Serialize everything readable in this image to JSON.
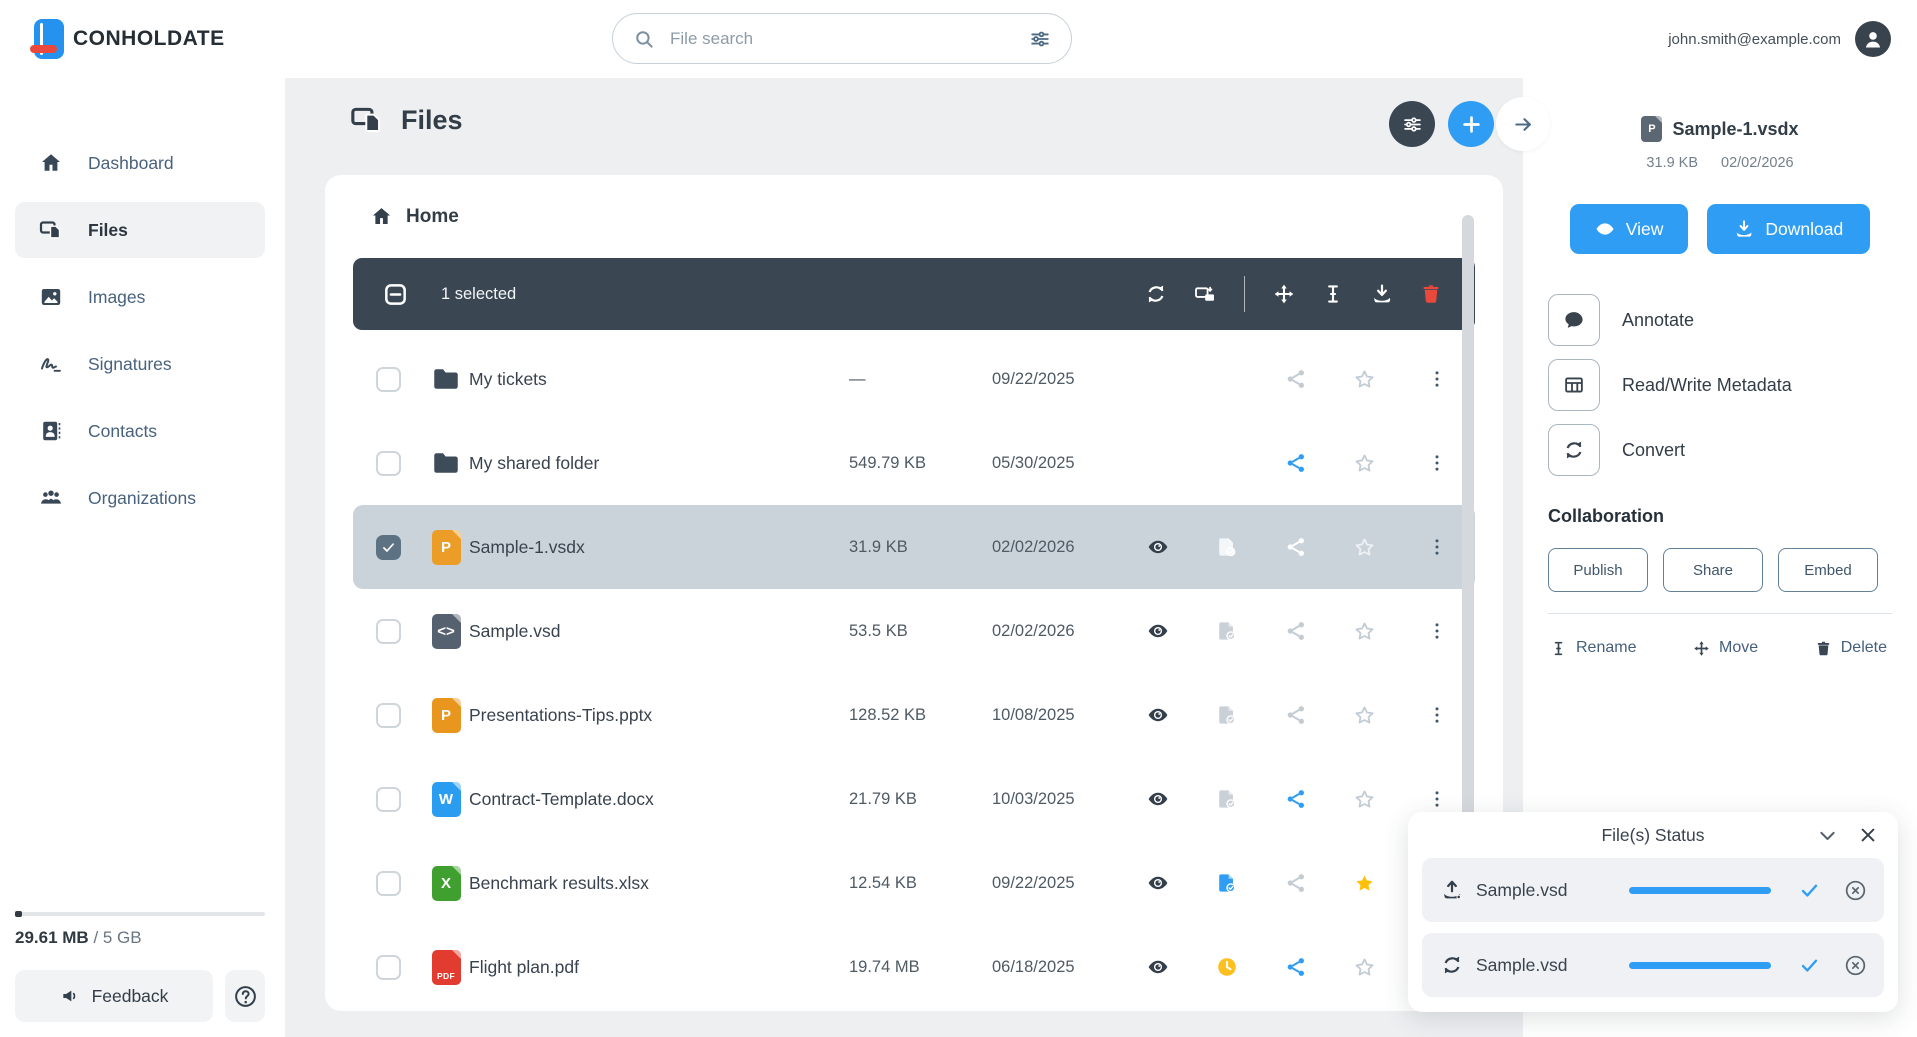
{
  "brand": {
    "name": "CONHOLDATE"
  },
  "topbar": {
    "search_placeholder": "File search",
    "user_email": "john.smith@example.com"
  },
  "sidebar": {
    "items": [
      {
        "label": "Dashboard",
        "icon": "home",
        "active": false
      },
      {
        "label": "Files",
        "icon": "files",
        "active": true
      },
      {
        "label": "Images",
        "icon": "image",
        "active": false
      },
      {
        "label": "Signatures",
        "icon": "signature",
        "active": false
      },
      {
        "label": "Contacts",
        "icon": "contact",
        "active": false
      },
      {
        "label": "Organizations",
        "icon": "people",
        "active": false
      }
    ],
    "storage": {
      "used": "29.61 MB",
      "quota": "/ 5 GB",
      "percent": 1
    },
    "feedback_label": "Feedback"
  },
  "main": {
    "title": "Files",
    "breadcrumb": {
      "label": "Home"
    },
    "header_buttons": [
      {
        "name": "filter",
        "icon": "sliders"
      },
      {
        "name": "add",
        "icon": "plus"
      }
    ],
    "toolbar": {
      "selected_text": "1 selected",
      "actions": [
        {
          "name": "convert",
          "icon": "refresh"
        },
        {
          "name": "compare",
          "icon": "compare"
        },
        {
          "divider": true
        },
        {
          "name": "move",
          "icon": "move"
        },
        {
          "name": "rename",
          "icon": "ibeam"
        },
        {
          "name": "download",
          "icon": "download"
        },
        {
          "name": "delete",
          "icon": "trash",
          "danger": true
        }
      ]
    },
    "file_types": {
      "folder": {
        "badge": "",
        "color": "#3e4b59"
      },
      "vsdx": {
        "badge": "P",
        "color": "#eb9d27"
      },
      "vsd": {
        "badge": "<>",
        "color": "#55616e"
      },
      "pptx": {
        "badge": "P",
        "color": "#e8961e"
      },
      "docx": {
        "badge": "W",
        "color": "#2b9df0"
      },
      "xlsx": {
        "badge": "X",
        "color": "#3f9f2f"
      },
      "pdf": {
        "badge": "PDF",
        "color": "#e23c30"
      }
    },
    "files": [
      {
        "name": "My tickets",
        "type": "folder",
        "size": "—",
        "date": "09/22/2025",
        "selected": false,
        "actions": {
          "share": "muted",
          "star": "outline",
          "menu": true
        }
      },
      {
        "name": "My shared folder",
        "type": "folder",
        "size": "549.79 KB",
        "date": "05/30/2025",
        "selected": false,
        "actions": {
          "share": "blue",
          "star": "outline",
          "menu": true
        }
      },
      {
        "name": "Sample-1.vsdx",
        "type": "vsdx",
        "size": "31.9 KB",
        "date": "02/02/2026",
        "selected": true,
        "actions": {
          "eye": true,
          "doc": "light",
          "share": "white",
          "star": "light-outline",
          "menu": true
        }
      },
      {
        "name": "Sample.vsd",
        "type": "vsd",
        "size": "53.5 KB",
        "date": "02/02/2026",
        "selected": false,
        "actions": {
          "eye": true,
          "doc": "muted",
          "share": "muted",
          "star": "outline",
          "menu": true
        }
      },
      {
        "name": "Presentations-Tips.pptx",
        "type": "pptx",
        "size": "128.52 KB",
        "date": "10/08/2025",
        "selected": false,
        "actions": {
          "eye": true,
          "doc": "muted",
          "share": "muted",
          "star": "outline",
          "menu": true
        }
      },
      {
        "name": "Contract-Template.docx",
        "type": "docx",
        "size": "21.79 KB",
        "date": "10/03/2025",
        "selected": false,
        "actions": {
          "eye": true,
          "doc": "muted",
          "share": "blue",
          "star": "outline",
          "menu": true
        }
      },
      {
        "name": "Benchmark results.xlsx",
        "type": "xlsx",
        "size": "12.54 KB",
        "date": "09/22/2025",
        "selected": false,
        "actions": {
          "eye": true,
          "doc": "blue",
          "share": "muted",
          "star": "filled",
          "menu": true
        }
      },
      {
        "name": "Flight plan.pdf",
        "type": "pdf",
        "size": "19.74 MB",
        "date": "06/18/2025",
        "selected": false,
        "actions": {
          "eye": true,
          "clock": true,
          "share": "blue",
          "star": "outline",
          "menu": true
        }
      }
    ]
  },
  "details": {
    "file_name": "Sample-1.vsdx",
    "file_type_badge": "P",
    "file_size": "31.9 KB",
    "file_date": "02/02/2026",
    "view_label": "View",
    "download_label": "Download",
    "actions": [
      {
        "label": "Annotate",
        "icon": "speech"
      },
      {
        "label": "Read/Write Metadata",
        "icon": "table"
      },
      {
        "label": "Convert",
        "icon": "refresh"
      }
    ],
    "collaboration": {
      "title": "Collaboration",
      "buttons": [
        "Publish",
        "Share",
        "Embed"
      ]
    },
    "file_ops": [
      {
        "label": "Rename",
        "icon": "ibeam"
      },
      {
        "label": "Move",
        "icon": "move"
      },
      {
        "label": "Delete",
        "icon": "trash"
      }
    ]
  },
  "status_panel": {
    "title": "File(s) Status",
    "items": [
      {
        "name": "Sample.vsd",
        "icon": "upload",
        "progress": 100
      },
      {
        "name": "Sample.vsd",
        "icon": "refresh",
        "progress": 100
      }
    ]
  },
  "colors": {
    "accent": "#2f9df4",
    "dark": "#3a4652",
    "star": "#ffc107",
    "danger": "#e8493c",
    "clock": "#fdc021"
  }
}
